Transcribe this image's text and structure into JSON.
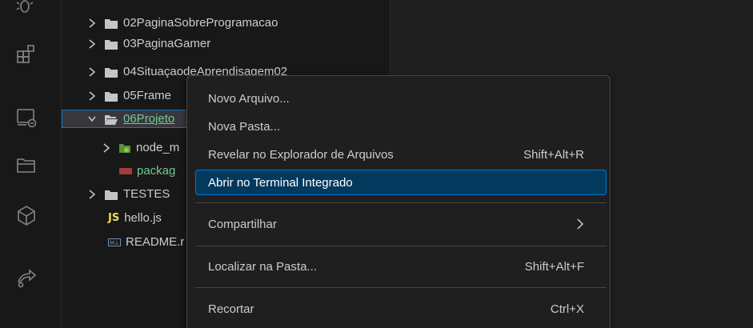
{
  "colors": {
    "background": "#1f1f1f",
    "sidebar": "#181818",
    "accent": "#0078d4",
    "menu_highlight": "#04395e",
    "git_green": "#73c991",
    "folder": "#c5c5c5"
  },
  "activity_bar": {
    "icons": [
      "debug-icon",
      "extensions-icon",
      "remote-explorer-icon",
      "folder-icon",
      "box-icon",
      "live-share-icon"
    ]
  },
  "explorer": {
    "rows": [
      {
        "label": "02PaginaSobreProgramacao",
        "type": "folder",
        "expanded": false
      },
      {
        "label": "03PaginaGamer",
        "type": "folder",
        "expanded": false
      },
      {
        "label": "04SituaçaodeAprendisagem02",
        "type": "folder",
        "expanded": false
      },
      {
        "label": "05Frame",
        "type": "folder",
        "expanded": false
      },
      {
        "label": "06Projeto",
        "type": "folder",
        "expanded": true,
        "selected": true
      },
      {
        "label": "node_m",
        "type": "node-folder",
        "expanded": false
      },
      {
        "label": "packag",
        "type": "npm-file"
      },
      {
        "label": "TESTES",
        "type": "folder",
        "expanded": false
      },
      {
        "label": "hello.js",
        "type": "js-file",
        "badge": "JS"
      },
      {
        "label": "README.r",
        "type": "md-file",
        "badge": "M↓"
      }
    ]
  },
  "context_menu": {
    "items": [
      {
        "label": "Novo Arquivo...",
        "shortcut": ""
      },
      {
        "label": "Nova Pasta...",
        "shortcut": ""
      },
      {
        "label": "Revelar no Explorador de Arquivos",
        "shortcut": "Shift+Alt+R"
      },
      {
        "label": "Abrir no Terminal Integrado",
        "shortcut": "",
        "active": true
      },
      {
        "label": "Compartilhar",
        "shortcut": "",
        "submenu": true
      },
      {
        "label": "Localizar na Pasta...",
        "shortcut": "Shift+Alt+F"
      },
      {
        "label": "Recortar",
        "shortcut": "Ctrl+X"
      }
    ]
  }
}
